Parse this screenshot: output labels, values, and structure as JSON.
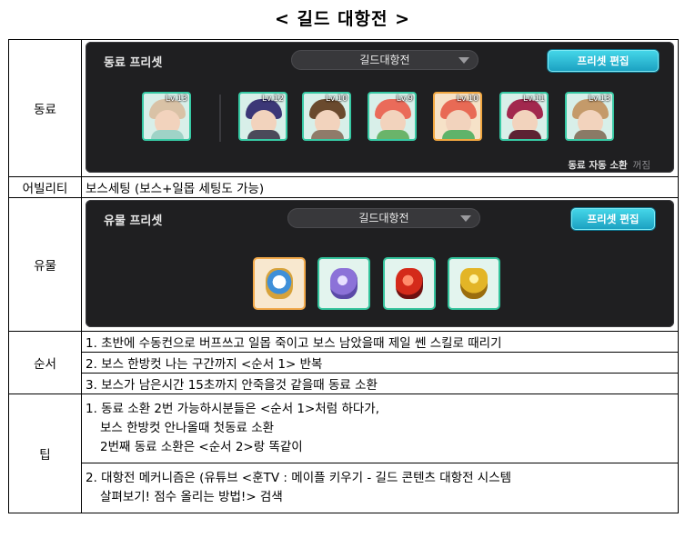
{
  "title": "< 길드 대항전 >",
  "rows": {
    "companion": {
      "label": "동료",
      "panel": {
        "title": "동료 프리셋",
        "preset_value": "길드대항전",
        "edit_label": "프리셋 편집",
        "auto_summon_label": "동료 자동 소환",
        "auto_summon_state": "꺼짐",
        "portraits": [
          {
            "level": "Lv.13"
          },
          {
            "level": "Lv.12"
          },
          {
            "level": "Lv.10"
          },
          {
            "level": "Lv.9"
          },
          {
            "level": "Lv.10"
          },
          {
            "level": "Lv.11"
          },
          {
            "level": "Lv.13"
          }
        ]
      }
    },
    "ability": {
      "label": "어빌리티",
      "text": "보스세팅 (보스+일몹 세팅도 가능)"
    },
    "relic": {
      "label": "유물",
      "panel": {
        "title": "유물 프리셋",
        "preset_value": "길드대항전",
        "edit_label": "프리셋 편집"
      }
    },
    "order": {
      "label": "순서",
      "items": [
        "1. 초반에 수동컨으로 버프쓰고 일몹 죽이고 보스 남았을때 제일 쎈 스킬로 때리기",
        "2. 보스 한방컷 나는 구간까지 <순서 1> 반복",
        "3. 보스가 남은시간 15초까지 안죽을것 같을때 동료 소환"
      ]
    },
    "tip": {
      "label": "팁",
      "tip1": {
        "line1": "1. 동료 소환 2번 가능하시분들은 <순서 1>처럼 하다가,",
        "line2": "보스 한방컷 안나올때 첫동료 소환",
        "line3": "2번째 동료 소환은 <순서 2>랑 똑같이"
      },
      "tip2": {
        "line1": "2. 대항전 메커니즘은 (유튜브 <훈TV : 메이플 키우기 - 길드 콘텐츠 대항전 시스템",
        "line2": "살펴보기! 점수 올리는 방법!> 검색"
      }
    }
  },
  "colors": {
    "panel_bg": "#1f1f21",
    "accent_cyan": "#1fb3d2",
    "frame_green": "#37c9a4",
    "frame_orange": "#f0a640"
  }
}
